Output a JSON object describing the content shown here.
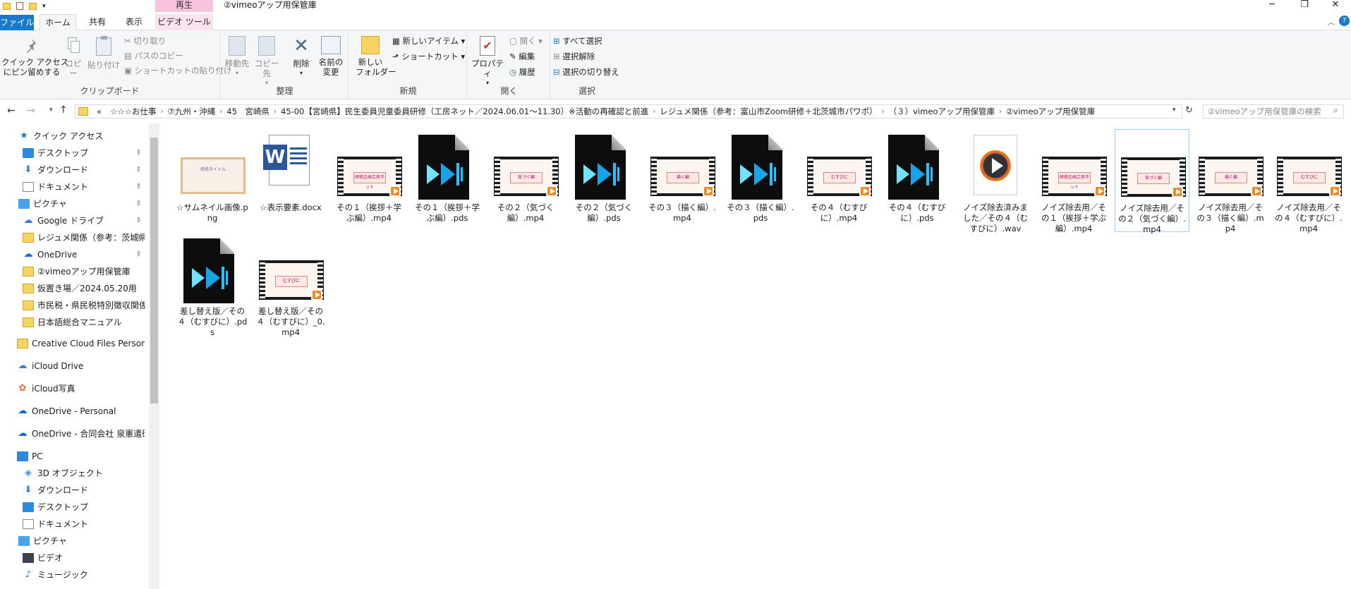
{
  "window": {
    "title": "②vimeoアップ用保管庫",
    "contextual_tab": "再生",
    "controls": {
      "minimize": "─",
      "maximize": "❐",
      "close": "✕"
    }
  },
  "tabs": [
    "ファイル",
    "ホーム",
    "共有",
    "表示",
    "ビデオ ツール"
  ],
  "ribbon": {
    "clipboard": {
      "label": "クリップボード",
      "pin": "クイック アクセス\nにピン留めする",
      "copy": "コピー",
      "paste": "貼り付け",
      "cut": "切り取り",
      "copy_path": "パスのコピー",
      "paste_shortcut": "ショートカットの貼り付け"
    },
    "organize": {
      "label": "整理",
      "move_to": "移動先",
      "copy_to": "コピー先",
      "delete": "削除",
      "rename": "名前の\n変更"
    },
    "new": {
      "label": "新規",
      "new_folder": "新しい\nフォルダー",
      "new_item": "新しいアイテム ▾",
      "shortcut": "ショートカット ▾"
    },
    "open": {
      "label": "開く",
      "properties": "プロパティ",
      "open": "開く ▾",
      "edit": "編集",
      "history": "履歴"
    },
    "select": {
      "label": "選択",
      "select_all": "すべて選択",
      "select_none": "選択解除",
      "invert": "選択の切り替え"
    }
  },
  "address": {
    "prefix": "«",
    "crumbs": [
      "☆☆☆お仕事",
      "⑦九州・沖縄",
      "45　宮崎県",
      "45-00【宮崎県】民生委員児童委員研修（工房ネット／2024.06.01〜11.30）※活動の再確認と前進",
      "レジュメ関係（参考：富山市Zoom研修＋北茨城市パワポ）",
      "（３）vimeoアップ用保管庫",
      "②vimeoアップ用保管庫"
    ],
    "search_placeholder": "②vimeoアップ用保管庫の検索"
  },
  "nav": {
    "items": [
      {
        "label": "クイック アクセス",
        "icon": "star-icon",
        "pinned": false
      },
      {
        "label": "デスクトップ",
        "icon": "desktop-icon",
        "pinned": true
      },
      {
        "label": "ダウンロード",
        "icon": "download-icon",
        "pinned": true
      },
      {
        "label": "ドキュメント",
        "icon": "document-icon",
        "pinned": true
      },
      {
        "label": "ピクチャ",
        "icon": "pictures-icon",
        "pinned": true
      },
      {
        "label": "Google ドライブ",
        "icon": "cloud-icon",
        "pinned": true
      },
      {
        "label": "レジュメ関係（参考：茨城県",
        "icon": "folder-icon",
        "pinned": true
      },
      {
        "label": "OneDrive",
        "icon": "onedrive-icon",
        "pinned": true
      },
      {
        "label": "②vimeoアップ用保管庫",
        "icon": "folder-icon",
        "pinned": false
      },
      {
        "label": "仮置き場／2024.05.20用",
        "icon": "folder-icon",
        "pinned": false
      },
      {
        "label": "市民税・県民税特別徴収関係",
        "icon": "folder-icon",
        "pinned": false
      },
      {
        "label": "日本語総合マニュアル",
        "icon": "folder-icon",
        "pinned": false
      },
      {
        "label": "Creative Cloud Files Personal Ac",
        "icon": "folder-icon",
        "pinned": false
      },
      {
        "label": "iCloud Drive",
        "icon": "icloud-icon",
        "pinned": false
      },
      {
        "label": "iCloud写真",
        "icon": "photos-icon",
        "pinned": false
      },
      {
        "label": "OneDrive - Personal",
        "icon": "onedrive-icon",
        "pinned": false
      },
      {
        "label": "OneDrive - 合同会社 泉憲遣研修",
        "icon": "onedrive-icon",
        "pinned": false
      },
      {
        "label": "PC",
        "icon": "pc-icon",
        "pinned": false
      },
      {
        "label": "3D オブジェクト",
        "icon": "3d-objects-icon",
        "pinned": false
      },
      {
        "label": "ダウンロード",
        "icon": "download-icon",
        "pinned": false
      },
      {
        "label": "デスクトップ",
        "icon": "desktop-icon",
        "pinned": false
      },
      {
        "label": "ドキュメント",
        "icon": "document-icon",
        "pinned": false
      },
      {
        "label": "ピクチャ",
        "icon": "pictures-icon",
        "pinned": false
      },
      {
        "label": "ビデオ",
        "icon": "video-icon",
        "pinned": false
      },
      {
        "label": "ミュージック",
        "icon": "music-icon",
        "pinned": false
      }
    ]
  },
  "files": [
    {
      "name": "☆サムネイル画像.png",
      "type": "image",
      "thumb_title": "研修タイトル",
      "selected": false
    },
    {
      "name": "☆表示要素.docx",
      "type": "word",
      "selected": false
    },
    {
      "name": "その１（挨拶＋学ぶ編）.mp4",
      "type": "video",
      "slide": "研修企画工房ネット",
      "selected": false
    },
    {
      "name": "その１（挨拶＋学ぶ編）.pds",
      "type": "pds",
      "selected": false
    },
    {
      "name": "その２（気づく編）.mp4",
      "type": "video",
      "slide": "気づく編",
      "selected": false
    },
    {
      "name": "その２（気づく編）.pds",
      "type": "pds",
      "selected": false
    },
    {
      "name": "その３（描く編）.mp4",
      "type": "video",
      "slide": "描く編",
      "selected": false
    },
    {
      "name": "その３（描く編）.pds",
      "type": "pds",
      "selected": false
    },
    {
      "name": "その４（むすびに）.mp4",
      "type": "video",
      "slide": "むすびに",
      "selected": false
    },
    {
      "name": "その４（むすびに）.pds",
      "type": "pds",
      "selected": false
    },
    {
      "name": "ノイズ除去済みました／その４（むすびに）.wav",
      "type": "audio",
      "selected": false
    },
    {
      "name": "ノイズ除去用／その１（挨拶＋学ぶ編）.mp4",
      "type": "video",
      "slide": "研修企画工房ネット",
      "selected": false
    },
    {
      "name": "ノイズ除去用／その２（気づく編）.mp4",
      "type": "video",
      "slide": "気づく編",
      "selected": true
    },
    {
      "name": "ノイズ除去用／その３（描く編）.mp4",
      "type": "video",
      "slide": "描く編",
      "selected": false
    },
    {
      "name": "ノイズ除去用／その４（むすびに）.mp4",
      "type": "video",
      "slide": "むすびに",
      "selected": false
    },
    {
      "name": "差し替え版／その４（むすびに）.pds",
      "type": "pds",
      "selected": false
    },
    {
      "name": "差し替え版／その４（むすびに）_0.mp4",
      "type": "video",
      "slide": "むすびに",
      "selected": false
    }
  ],
  "colors": {
    "accent": "#1979ca",
    "context": "#f7c3df",
    "selection": "#99d1ff"
  }
}
